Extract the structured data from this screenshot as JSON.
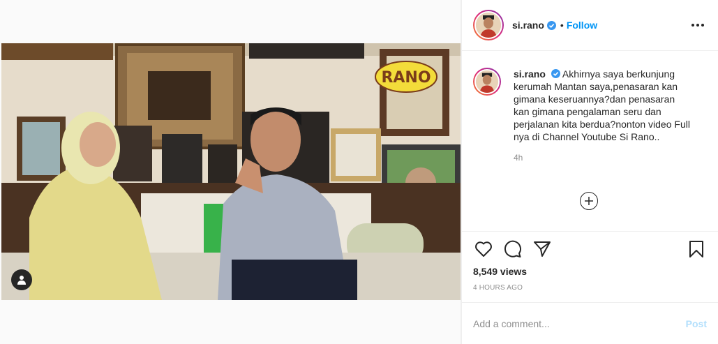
{
  "post": {
    "username": "si.rano",
    "separator": "•",
    "follow_label": "Follow",
    "caption": "Akhirnya saya berkunjung kerumah Mantan saya,penasaran kan gimana keseruannya?dan penasaran kan gimana pengalaman seru dan perjalanan kita berdua?nonton video Full nya di Channel Youtube Si Rano..",
    "relative_time": "4h",
    "views": "8,549 views",
    "absolute_time": "4 HOURS AGO",
    "video_watermark": "RANO"
  },
  "comment": {
    "placeholder": "Add a comment...",
    "post_label": "Post"
  },
  "icons": {
    "verified": "verified-badge-icon",
    "more": "more-options-icon",
    "like": "heart-icon",
    "comment": "comment-bubble-icon",
    "share": "paper-plane-icon",
    "save": "bookmark-icon",
    "load_more": "plus-circle-icon",
    "user_tag": "user-tag-icon"
  },
  "colors": {
    "link_blue": "#0095f6",
    "post_disabled": "#b2dffc",
    "muted_text": "#8e8e8e",
    "border": "#efefef"
  }
}
